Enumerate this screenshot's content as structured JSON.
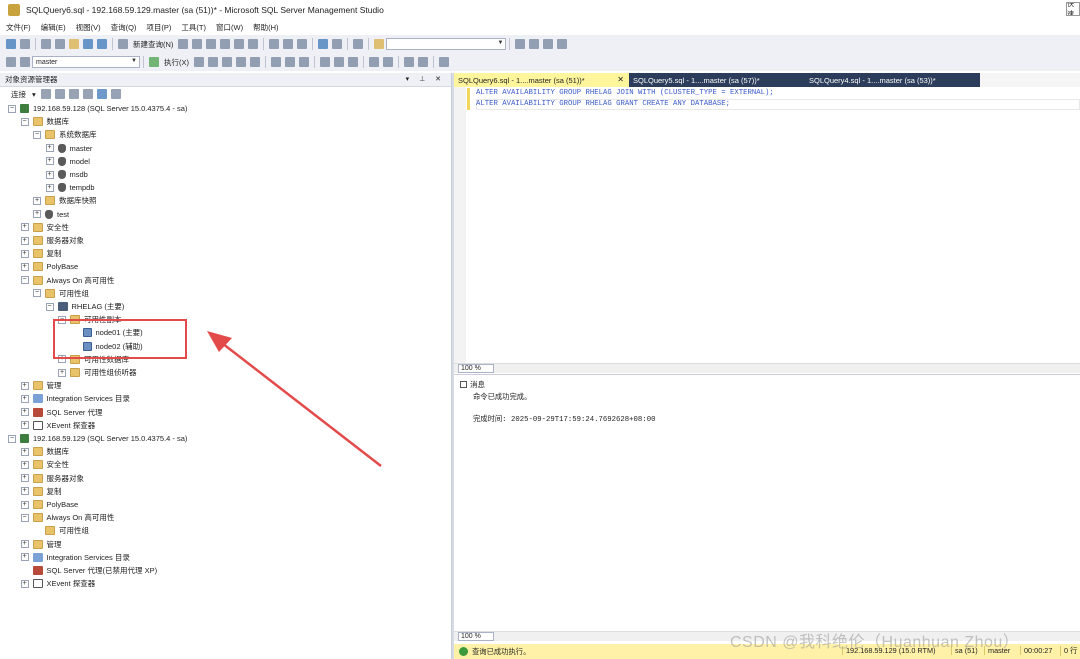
{
  "window": {
    "title": "SQLQuery6.sql - 192.168.59.129.master (sa (51))* - Microsoft SQL Server Management Studio",
    "quick_launch": "快速"
  },
  "menu": [
    "文件(F)",
    "编辑(E)",
    "视图(V)",
    "查询(Q)",
    "项目(P)",
    "工具(T)",
    "窗口(W)",
    "帮助(H)"
  ],
  "toolbar": {
    "new_query": "新建查询(N)",
    "execute": "执行(X)",
    "database": "master"
  },
  "object_explorer": {
    "title": "对象资源管理器",
    "connect": "连接",
    "tree": [
      {
        "id": "srv1",
        "label": "192.168.59.128 (SQL Server 15.0.4375.4 - sa)",
        "icon": "server-icon",
        "level": 0,
        "expand": "minus"
      },
      {
        "id": "databases1",
        "label": "数据库",
        "icon": "folder-icon",
        "level": 1,
        "expand": "minus"
      },
      {
        "id": "sysdb",
        "label": "系统数据库",
        "icon": "folder-icon",
        "level": 2,
        "expand": "minus"
      },
      {
        "id": "master",
        "label": "master",
        "icon": "database-icon",
        "level": 3,
        "expand": "plus"
      },
      {
        "id": "model",
        "label": "model",
        "icon": "database-icon",
        "level": 3,
        "expand": "plus"
      },
      {
        "id": "msdb",
        "label": "msdb",
        "icon": "database-icon",
        "level": 3,
        "expand": "plus"
      },
      {
        "id": "tempdb",
        "label": "tempdb",
        "icon": "database-icon",
        "level": 3,
        "expand": "plus"
      },
      {
        "id": "snapshots",
        "label": "数据库快照",
        "icon": "folder-icon",
        "level": 2,
        "expand": "plus"
      },
      {
        "id": "test",
        "label": "test",
        "icon": "database-icon",
        "level": 2,
        "expand": "plus"
      },
      {
        "id": "security1",
        "label": "安全性",
        "icon": "folder-icon",
        "level": 1,
        "expand": "plus"
      },
      {
        "id": "srvobj1",
        "label": "服务器对象",
        "icon": "folder-icon",
        "level": 1,
        "expand": "plus"
      },
      {
        "id": "repl1",
        "label": "复制",
        "icon": "folder-icon",
        "level": 1,
        "expand": "plus"
      },
      {
        "id": "polybase1",
        "label": "PolyBase",
        "icon": "folder-icon",
        "level": 1,
        "expand": "plus"
      },
      {
        "id": "alwayson1",
        "label": "Always On 高可用性",
        "icon": "folder-icon",
        "level": 1,
        "expand": "minus"
      },
      {
        "id": "ag1",
        "label": "可用性组",
        "icon": "folder-icon",
        "level": 2,
        "expand": "minus"
      },
      {
        "id": "rhelag",
        "label": "RHELAG (主要)",
        "icon": "availability-group-icon",
        "level": 3,
        "expand": "minus"
      },
      {
        "id": "replicas",
        "label": "可用性副本",
        "icon": "folder-icon",
        "level": 4,
        "expand": "minus"
      },
      {
        "id": "node01",
        "label": "node01 (主要)",
        "icon": "replica-icon",
        "level": 5,
        "expand": "none"
      },
      {
        "id": "node02",
        "label": "node02 (辅助)",
        "icon": "replica-icon",
        "level": 5,
        "expand": "none"
      },
      {
        "id": "agdbs",
        "label": "可用性数据库",
        "icon": "folder-icon",
        "level": 4,
        "expand": "plus"
      },
      {
        "id": "listeners",
        "label": "可用性组侦听器",
        "icon": "folder-icon",
        "level": 4,
        "expand": "plus"
      },
      {
        "id": "mgmt1",
        "label": "管理",
        "icon": "folder-icon",
        "level": 1,
        "expand": "plus"
      },
      {
        "id": "is1",
        "label": "Integration Services 目录",
        "icon": "integration-services-icon",
        "level": 1,
        "expand": "plus"
      },
      {
        "id": "agent1",
        "label": "SQL Server 代理",
        "icon": "sql-agent-icon",
        "level": 1,
        "expand": "plus"
      },
      {
        "id": "xevent1",
        "label": "XEvent 探查器",
        "icon": "xevent-icon",
        "level": 1,
        "expand": "plus"
      },
      {
        "id": "srv2",
        "label": "192.168.59.129 (SQL Server 15.0.4375.4 - sa)",
        "icon": "server-icon",
        "level": 0,
        "expand": "minus"
      },
      {
        "id": "databases2",
        "label": "数据库",
        "icon": "folder-icon",
        "level": 1,
        "expand": "plus"
      },
      {
        "id": "security2",
        "label": "安全性",
        "icon": "folder-icon",
        "level": 1,
        "expand": "plus"
      },
      {
        "id": "srvobj2",
        "label": "服务器对象",
        "icon": "folder-icon",
        "level": 1,
        "expand": "plus"
      },
      {
        "id": "repl2",
        "label": "复制",
        "icon": "folder-icon",
        "level": 1,
        "expand": "plus"
      },
      {
        "id": "polybase2",
        "label": "PolyBase",
        "icon": "folder-icon",
        "level": 1,
        "expand": "plus"
      },
      {
        "id": "alwayson2",
        "label": "Always On 高可用性",
        "icon": "folder-icon",
        "level": 1,
        "expand": "minus"
      },
      {
        "id": "ag2",
        "label": "可用性组",
        "icon": "folder-icon",
        "level": 2,
        "expand": "none"
      },
      {
        "id": "mgmt2",
        "label": "管理",
        "icon": "folder-icon",
        "level": 1,
        "expand": "plus"
      },
      {
        "id": "is2",
        "label": "Integration Services 目录",
        "icon": "integration-services-icon",
        "level": 1,
        "expand": "plus"
      },
      {
        "id": "agent2",
        "label": "SQL Server 代理(已禁用代理 XP)",
        "icon": "sql-agent-disabled-icon",
        "level": 1,
        "expand": "none"
      },
      {
        "id": "xevent2",
        "label": "XEvent 探查器",
        "icon": "xevent-icon",
        "level": 1,
        "expand": "plus"
      }
    ]
  },
  "tabs": [
    {
      "label": "SQLQuery6.sql - 1....master (sa (51))*",
      "active": true
    },
    {
      "label": "SQLQuery5.sql - 1....master (sa (57))*",
      "active": false
    },
    {
      "label": "SQLQuery4.sql - 1....master (sa (53))*",
      "active": false
    }
  ],
  "editor": {
    "lines": [
      "ALTER AVAILABILITY GROUP RHELAG JOIN WITH (CLUSTER_TYPE = EXTERNAL);",
      "ALTER AVAILABILITY GROUP RHELAG GRANT CREATE ANY DATABASE;"
    ],
    "zoom": "100 %"
  },
  "results": {
    "tab": "消息",
    "message": "命令已成功完成。",
    "completion": "完成时间: 2025-09-29T17:59:24.7692628+08:00",
    "zoom": "100 %"
  },
  "status": {
    "message": "查询已成功执行。",
    "server": "192.168.59.129 (15.0 RTM)",
    "user": "sa (51)",
    "database": "master",
    "elapsed": "00:00:27",
    "rows": "0 行"
  },
  "watermark": "CSDN @我科绝伦（Huanhuan Zhou）",
  "colors": {
    "accent_tab": "#fff59d",
    "inactive_tab": "#2b3d5a",
    "status_bar": "#fff2a8",
    "annotation": "#e34b4b"
  }
}
